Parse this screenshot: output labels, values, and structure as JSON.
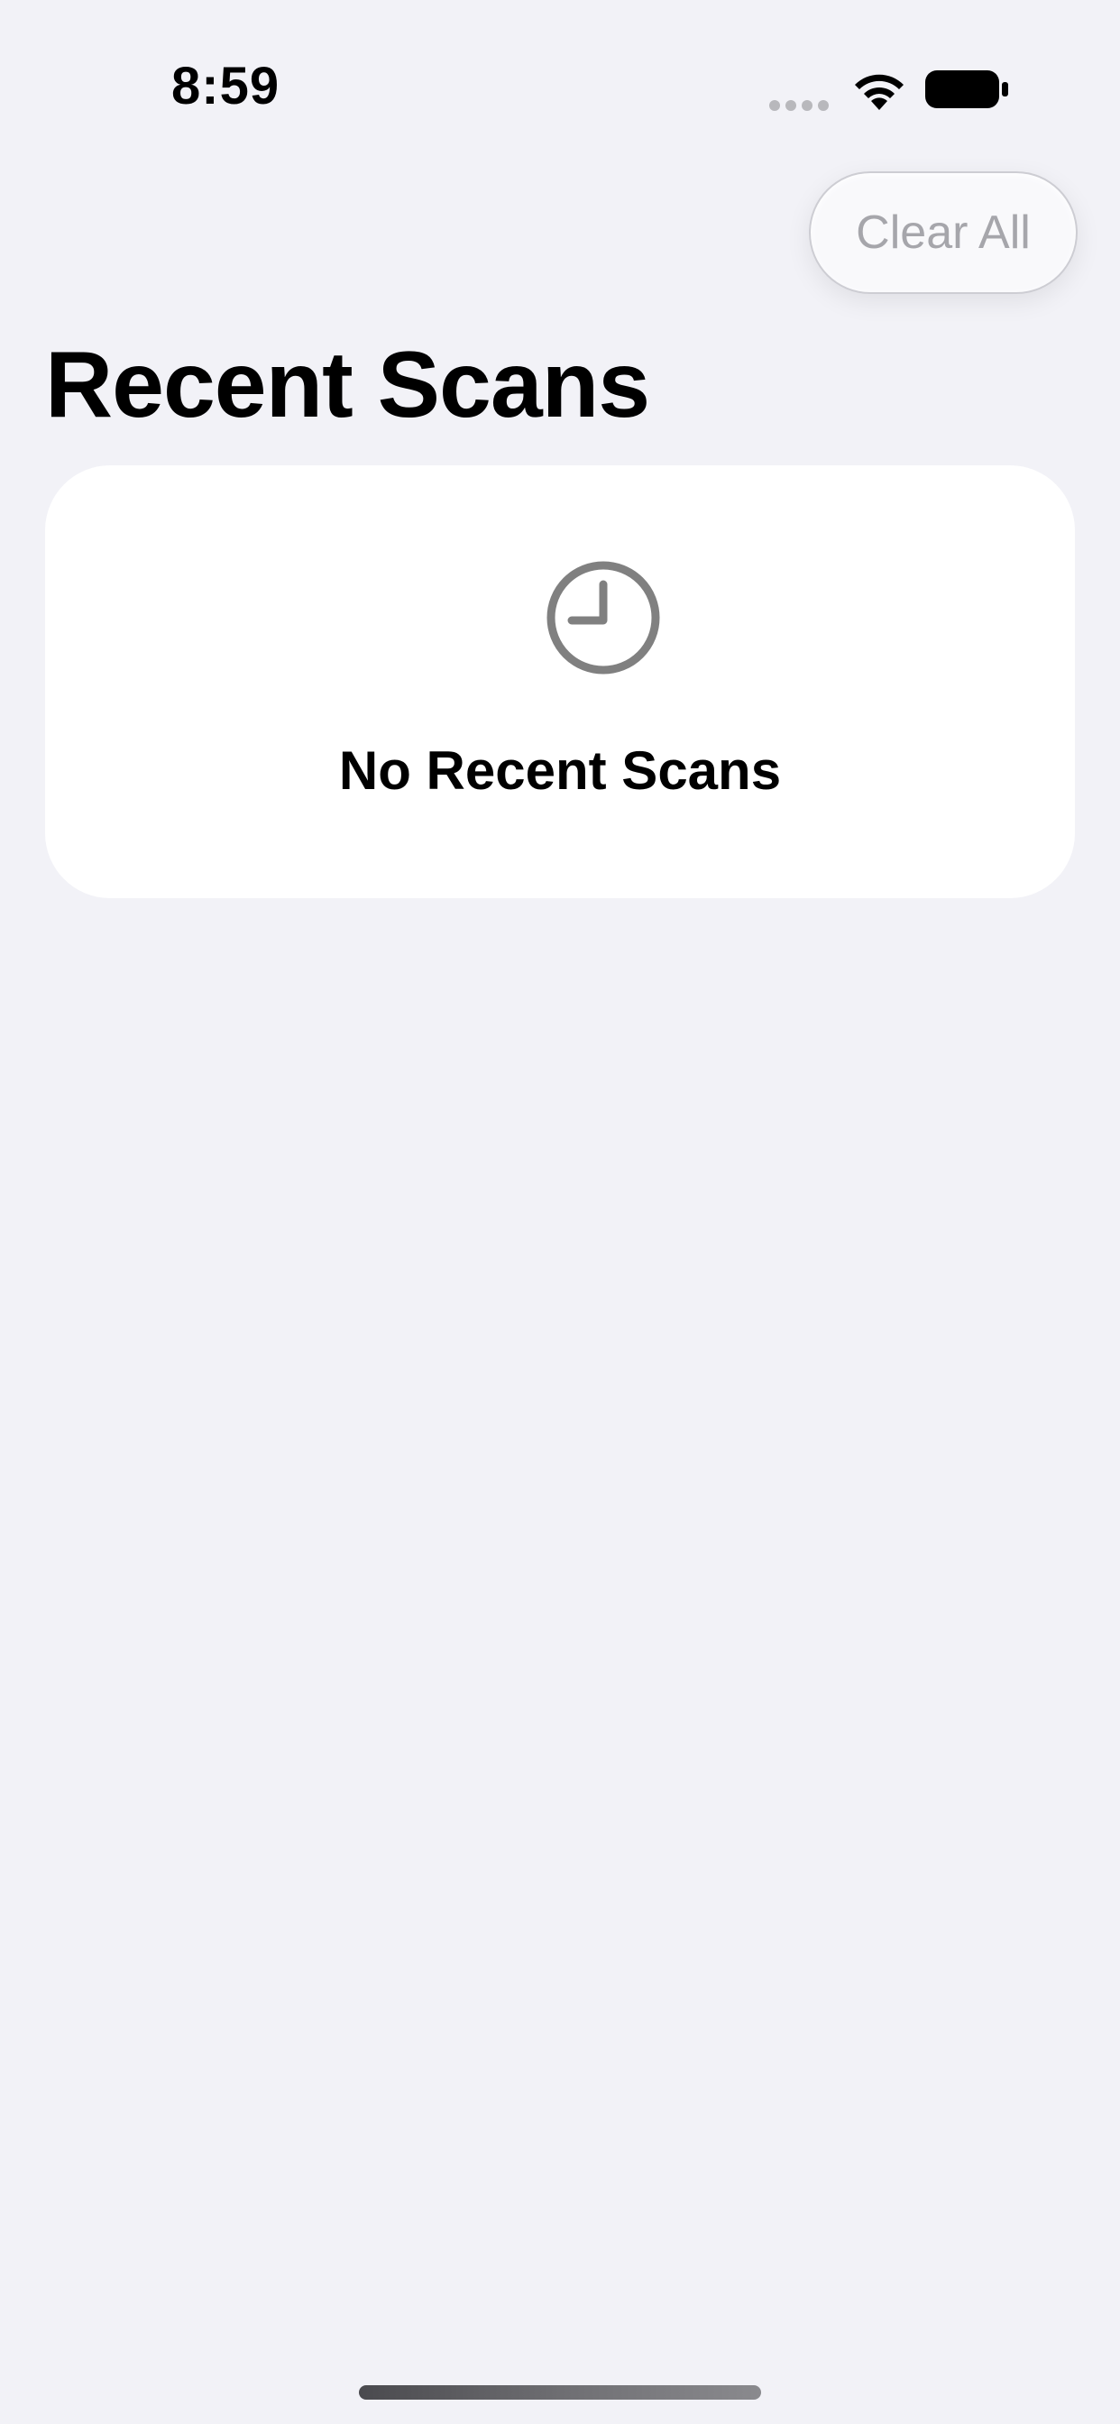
{
  "status_bar": {
    "time": "8:59",
    "icons": [
      "cellular-signal-icon",
      "wifi-icon",
      "battery-icon"
    ]
  },
  "toolbar": {
    "clear_all_label": "Clear All"
  },
  "header": {
    "title": "Recent Scans"
  },
  "empty_state": {
    "icon": "clock-icon",
    "title": "No Recent Scans"
  },
  "colors": {
    "background": "#F2F2F7",
    "card": "#FFFFFF",
    "disabled_text": "#A6A6AB",
    "icon_gray": "#808080"
  }
}
